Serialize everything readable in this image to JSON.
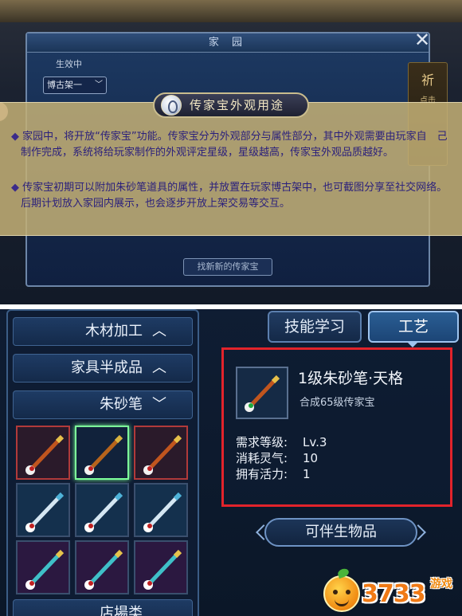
{
  "home_panel": {
    "title": "家 园",
    "effect_label": "生效中",
    "dropdown_value": "博古架一",
    "side_char": "祈",
    "side_sub": "点击",
    "find_button": "找新新的传家宝"
  },
  "info": {
    "title": "传家宝外观用途",
    "paragraphs": [
      "家园中，将开放“传家宝”功能。传家宝分为外观部分与属性部分，其中外观需要由玩家自　己制作完成，系统将给玩家制作的外观评定星级，星级越高，传家宝外观品质越好。",
      "传家宝初期可以附加朱砂笔道具的属性，并放置在玩家博古架中，也可截图分享至社交网络。后期计划放入家园内展示，也会逐步开放上架交易等交互。"
    ]
  },
  "craft": {
    "categories": [
      {
        "label": "木材加工",
        "chevron": "up"
      },
      {
        "label": "家具半成品",
        "chevron": "up"
      },
      {
        "label": "朱砂笔",
        "chevron": "down"
      },
      {
        "label": "店場类",
        "chevron": "none"
      }
    ],
    "tabs": {
      "skill": "技能学习",
      "craft": "工艺"
    },
    "selected_item": {
      "name": "1级朱砂笔·天格",
      "subtitle": "合成65级传家宝",
      "stats": [
        {
          "label": "需求等级:",
          "value": "Lv.3"
        },
        {
          "label": "消耗灵气:",
          "value": "10"
        },
        {
          "label": "拥有活力:",
          "value": "1"
        }
      ]
    },
    "partner_button": "可伴生物品"
  },
  "watermark": {
    "number": "3733",
    "suffix": "游戏"
  },
  "colors": {
    "overlay": "#c4b076",
    "highlight_border": "#e2232b",
    "selected_slot": "#7dff9a",
    "text_purple": "#2a1f7c"
  }
}
